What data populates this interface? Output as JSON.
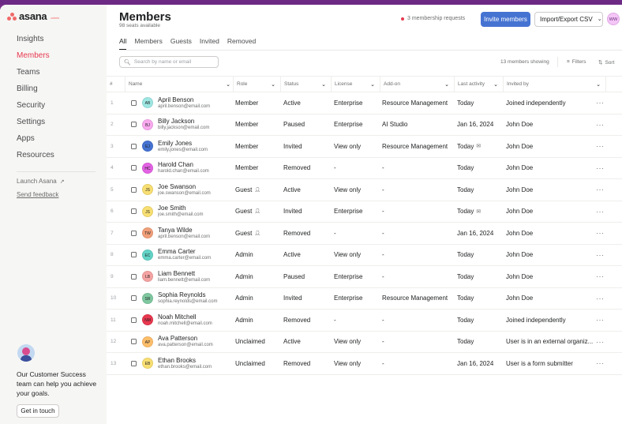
{
  "app": {
    "logo_text": "asana",
    "logo_sub": "admin"
  },
  "sidebar": {
    "items": [
      {
        "label": "Insights",
        "active": false
      },
      {
        "label": "Members",
        "active": true
      },
      {
        "label": "Teams",
        "active": false
      },
      {
        "label": "Billing",
        "active": false
      },
      {
        "label": "Security",
        "active": false
      },
      {
        "label": "Settings",
        "active": false
      },
      {
        "label": "Apps",
        "active": false
      },
      {
        "label": "Resources",
        "active": false
      }
    ],
    "launch_label": "Launch Asana",
    "feedback_label": "Send feedback",
    "cs_text": "Our Customer Success team can help you achieve your goals.",
    "cs_button": "Get in touch"
  },
  "header": {
    "title": "Members",
    "subtitle": "98 seats available",
    "requests": "3 membership requests",
    "invite_label": "Invite members",
    "import_label": "Import/Export CSV",
    "user_initials": "WW"
  },
  "tabs": [
    "All",
    "Members",
    "Guests",
    "Invited",
    "Removed"
  ],
  "toolbar": {
    "search_placeholder": "Search by name or email",
    "showing": "13 members showing",
    "filters_label": "Filters",
    "sort_label": "Sort"
  },
  "columns": {
    "num": "#",
    "name": "Name",
    "role": "Role",
    "status": "Status",
    "license": "License",
    "addon": "Add-on",
    "activity": "Last activity",
    "invited": "Invited by"
  },
  "rows": [
    {
      "num": "1",
      "initials": "AB",
      "color": "#9ee7e3",
      "name": "April Benson",
      "email": "april.benson@email.com",
      "role": "Member",
      "guest": false,
      "status": "Active",
      "license": "Enterprise",
      "addon": "Resource Management",
      "activity": "Today",
      "mail": false,
      "invited": "Joined independently"
    },
    {
      "num": "2",
      "initials": "BJ",
      "color": "#f9aaef",
      "name": "Billy Jackson",
      "email": "billy.jackson@email.com",
      "role": "Member",
      "guest": false,
      "status": "Paused",
      "license": "Enterprise",
      "addon": "AI Studio",
      "activity": "Jan 16, 2024",
      "mail": false,
      "invited": "John Doe"
    },
    {
      "num": "3",
      "initials": "EJ",
      "color": "#4573d2",
      "name": "Emily Jones",
      "email": "emily.jones@email.com",
      "role": "Member",
      "guest": false,
      "status": "Invited",
      "license": "View only",
      "addon": "Resource Management",
      "activity": "Today",
      "mail": true,
      "invited": "John Doe"
    },
    {
      "num": "4",
      "initials": "HC",
      "color": "#e362e3",
      "name": "Harold Chan",
      "email": "harold.chan@email.com",
      "role": "Member",
      "guest": false,
      "status": "Removed",
      "license": "-",
      "addon": "-",
      "activity": "Today",
      "mail": false,
      "invited": "John Doe"
    },
    {
      "num": "5",
      "initials": "JS",
      "color": "#f8df72",
      "name": "Joe Swanson",
      "email": "joe.swanson@email.com",
      "role": "Guest",
      "guest": true,
      "status": "Active",
      "license": "View only",
      "addon": "-",
      "activity": "Today",
      "mail": false,
      "invited": "John Doe"
    },
    {
      "num": "6",
      "initials": "JS",
      "color": "#f8df72",
      "name": "Joe Smith",
      "email": "joe.smith@email.com",
      "role": "Guest",
      "guest": true,
      "status": "Invited",
      "license": "Enterprise",
      "addon": "-",
      "activity": "Today",
      "mail": true,
      "invited": "John Doe"
    },
    {
      "num": "7",
      "initials": "TW",
      "color": "#f1a07a",
      "name": "Tanya Wilde",
      "email": "april.benson@email.com",
      "role": "Guest",
      "guest": true,
      "status": "Removed",
      "license": "-",
      "addon": "-",
      "activity": "Jan 16, 2024",
      "mail": false,
      "invited": "John Doe"
    },
    {
      "num": "8",
      "initials": "EC",
      "color": "#62d4c7",
      "name": "Emma Carter",
      "email": "emma.carter@email.com",
      "role": "Admin",
      "guest": false,
      "status": "Active",
      "license": "View only",
      "addon": "-",
      "activity": "Today",
      "mail": false,
      "invited": "John Doe"
    },
    {
      "num": "9",
      "initials": "LB",
      "color": "#f5a3a3",
      "name": "Liam Bennett",
      "email": "liam.bennett@email.com",
      "role": "Admin",
      "guest": false,
      "status": "Paused",
      "license": "Enterprise",
      "addon": "-",
      "activity": "Today",
      "mail": false,
      "invited": "John Doe"
    },
    {
      "num": "10",
      "initials": "SR",
      "color": "#7fc8a0",
      "name": "Sophia Reynolds",
      "email": "sophia.reynolds@email.com",
      "role": "Admin",
      "guest": false,
      "status": "Invited",
      "license": "Enterprise",
      "addon": "Resource Management",
      "activity": "Today",
      "mail": false,
      "invited": "John Doe"
    },
    {
      "num": "11",
      "initials": "NM",
      "color": "#e8384f",
      "name": "Noah Mitchell",
      "email": "noah.mitchell@email.com",
      "role": "Admin",
      "guest": false,
      "status": "Removed",
      "license": "-",
      "addon": "-",
      "activity": "Today",
      "mail": false,
      "invited": "Joined independently"
    },
    {
      "num": "12",
      "initials": "AP",
      "color": "#fdbe6a",
      "name": "Ava Patterson",
      "email": "ava.patterson@email.com",
      "role": "Unclaimed",
      "guest": false,
      "status": "Active",
      "license": "View only",
      "addon": "-",
      "activity": "Today",
      "mail": false,
      "invited": "User is in an external organiz..."
    },
    {
      "num": "13",
      "initials": "EB",
      "color": "#f8df72",
      "name": "Ethan Brooks",
      "email": "ethan.brooks@email.com",
      "role": "Unclaimed",
      "guest": false,
      "status": "Removed",
      "license": "View only",
      "addon": "-",
      "activity": "Jan 16, 2024",
      "mail": false,
      "invited": "User is a form submitter"
    }
  ]
}
